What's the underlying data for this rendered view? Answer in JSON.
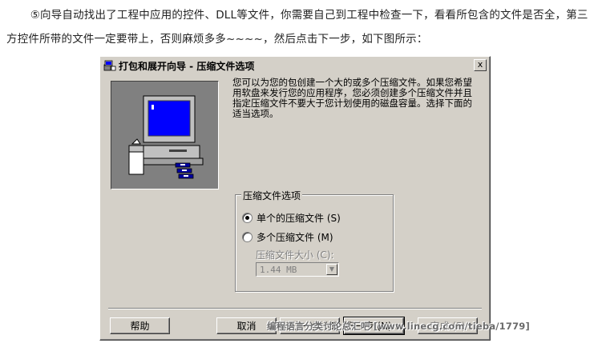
{
  "intro_text": "⑤向导自动找出了工程中应用的控件、DLL等文件，你需要自己到工程中检查一下，看看所包含的文件是否全，第三方控件所带的文件一定要带上，否则麻烦多多~~~~，然后点击下一步，如下图所示：",
  "dialog": {
    "title": "打包和展开向导 - 压缩文件选项",
    "close_label": "x",
    "description": "您可以为您的包创建一个大的或多个压缩文件。如果您希望用软盘来发行您的应用程序，您必须创建多个压缩文件并且指定压缩文件不要大于您计划使用的磁盘容量。选择下面的适当选项。",
    "group": {
      "title": "压缩文件选项",
      "options": [
        {
          "label": "单个的压缩文件 (S)",
          "checked": true
        },
        {
          "label": "多个压缩文件 (M)",
          "checked": false
        }
      ],
      "size_label": "压缩文件大小 (C):",
      "size_value": "1.44 MB"
    },
    "buttons": {
      "help": "帮助",
      "cancel": "取消",
      "back": "< 上一步 (B)",
      "next": "下一步 (N) >",
      "finish": "完成 (F)"
    }
  },
  "watermark": "编程语言分类讨论总汇吧 [www.linecg.com/tieba/1779]",
  "colors": {
    "dialog_bg": "#d4d0c8",
    "screen_blue": "#0000ff",
    "art_bg": "#808080"
  },
  "icons": [
    "setup-wizard-icon",
    "close-icon",
    "computer-illustration-icon",
    "floppy-disks-icon"
  ]
}
